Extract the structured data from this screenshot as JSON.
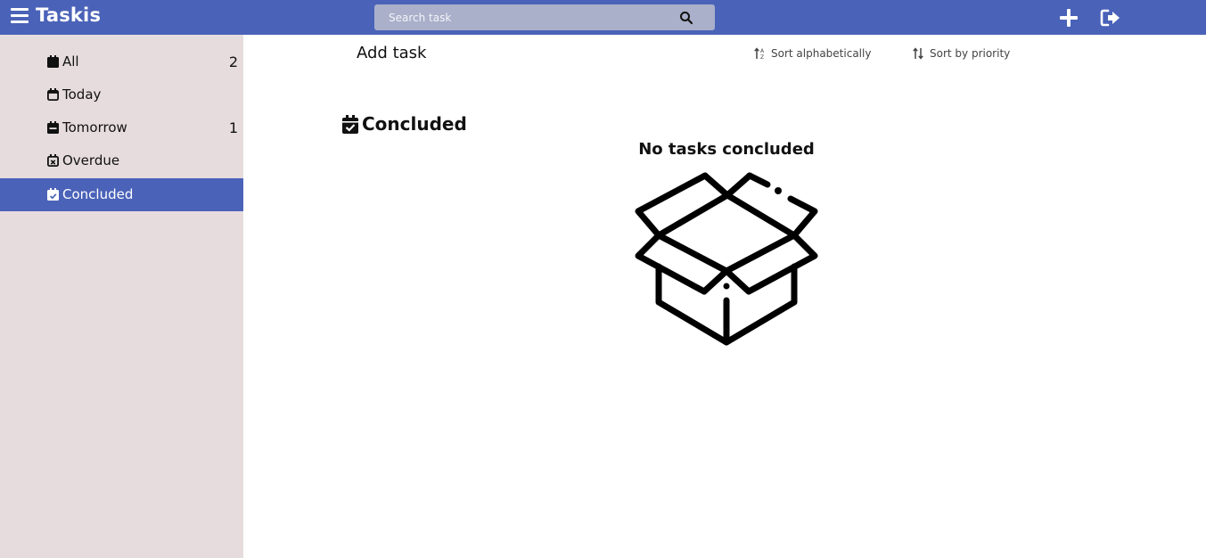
{
  "app": {
    "title": "Taskis"
  },
  "header": {
    "search": {
      "placeholder": "Search task"
    },
    "icons": [
      "menu-icon",
      "search-icon",
      "plus-icon",
      "logout-icon"
    ]
  },
  "sidebar": {
    "items": [
      {
        "label": "All",
        "count": "2",
        "icon": "calendar-full-icon"
      },
      {
        "label": "Today",
        "count": "",
        "icon": "calendar-outline-icon"
      },
      {
        "label": "Tomorrow",
        "count": "1",
        "icon": "calendar-minus-icon"
      },
      {
        "label": "Overdue",
        "count": "",
        "icon": "calendar-x-icon"
      },
      {
        "label": "Concluded",
        "count": "",
        "icon": "calendar-check-icon",
        "active": true
      }
    ]
  },
  "main": {
    "add_task_label": "Add task",
    "sort_alpha_label": "Sort alphabetically",
    "sort_priority_label": "Sort by priority",
    "section_title": "Concluded",
    "empty_message": "No tasks concluded",
    "empty_illustration": "open-box-icon"
  },
  "colors": {
    "accent": "#4a62b8",
    "sidebar_bg": "#e6dcdd",
    "search_bg": "#aab0ca"
  }
}
